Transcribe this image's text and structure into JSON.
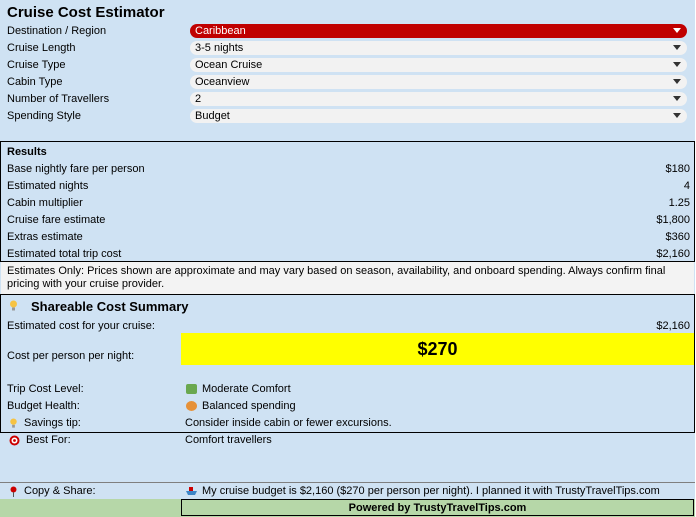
{
  "app": {
    "title": "Cruise Cost Estimator"
  },
  "inputs": [
    {
      "label": "Destination / Region",
      "value": "Caribbean",
      "highlight": true
    },
    {
      "label": "Cruise Length",
      "value": "3-5 nights"
    },
    {
      "label": "Cruise Type",
      "value": "Ocean Cruise"
    },
    {
      "label": "Cabin Type",
      "value": "Oceanview"
    },
    {
      "label": "Number of Travellers",
      "value": "2"
    },
    {
      "label": "Spending Style",
      "value": "Budget"
    }
  ],
  "results": {
    "heading": "Results",
    "rows": [
      {
        "label": "Base nightly fare per person",
        "value": "$180"
      },
      {
        "label": "Estimated nights",
        "value": "4"
      },
      {
        "label": "Cabin multiplier",
        "value": "1.25"
      },
      {
        "label": "Cruise fare estimate",
        "value": "$1,800"
      },
      {
        "label": "Extras estimate",
        "value": "$360"
      },
      {
        "label": "Estimated total trip cost",
        "value": "$2,160"
      }
    ],
    "note": "Estimates Only: Prices shown are approximate and may vary based on season, availability, and onboard spending. Always confirm final pricing with your cruise provider."
  },
  "summary": {
    "title": "Shareable Cost Summary",
    "estimated_label": "Estimated cost for your cruise:",
    "estimated_value": "$2,160",
    "per_night_label": "Cost per person per night:",
    "per_night_value": "$270",
    "trip_level_label": "Trip Cost Level:",
    "trip_level_value": "Moderate Comfort",
    "budget_health_label": "Budget Health:",
    "budget_health_value": "Balanced spending",
    "savings_label": "Savings tip:",
    "savings_value": "Consider inside cabin or fewer excursions.",
    "best_for_label": "Best For:",
    "best_for_value": "Comfort travellers",
    "share_label": "Copy & Share:",
    "share_value": "My cruise budget is $2,160 ($270 per person per night). I planned it with TrustyTravelTips.com",
    "powered_by": "Powered by TrustyTravelTips.com"
  },
  "colors": {
    "sheet_bg": "#cfe2f3",
    "highlight_dropdown": "#c00000",
    "per_night_highlight": "#ffff00",
    "footer_bg": "#b6d7a8"
  },
  "icons": [
    "lightbulb-icon",
    "money-icon",
    "cookie-icon",
    "target-icon",
    "pin-icon",
    "ship-icon"
  ]
}
